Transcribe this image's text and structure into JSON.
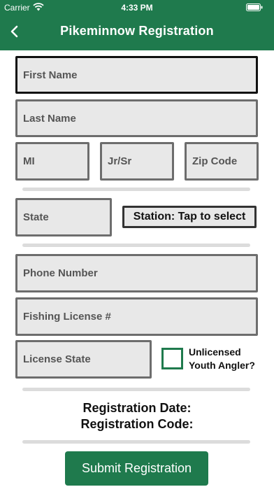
{
  "status_bar": {
    "carrier": "Carrier",
    "time": "4:33 PM"
  },
  "header": {
    "title": "Pikeminnow Registration",
    "back_icon": "chevron-left-icon"
  },
  "form": {
    "first_name": "First Name",
    "last_name": "Last Name",
    "mi": "MI",
    "jr_sr": "Jr/Sr",
    "zip_code": "Zip Code",
    "state": "State",
    "station": "Station: Tap to select",
    "phone_number": "Phone Number",
    "fishing_license": "Fishing License #",
    "license_state": "License State",
    "youth_angler_line1": "Unlicensed",
    "youth_angler_line2": "Youth Angler?",
    "youth_angler_checked": false
  },
  "registration": {
    "date_label": "Registration Date:",
    "code_label": "Registration Code:"
  },
  "submit_label": "Submit Registration",
  "colors": {
    "accent": "#1f7a4d",
    "field_bg": "#e8e8e8",
    "field_border": "#6d6d6d"
  }
}
